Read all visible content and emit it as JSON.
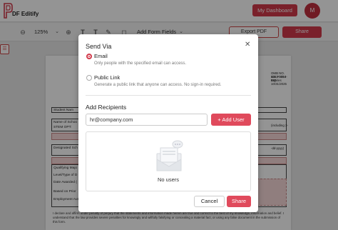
{
  "app": {
    "logo_text": "DF Editify"
  },
  "header": {
    "dashboard_label": "My Dashboard",
    "avatar_initial": "M"
  },
  "toolbar": {
    "zoom": "125%",
    "add_form_fields": "Add Form Fields",
    "export_label": "Export PDF",
    "share_label": "Share"
  },
  "document": {
    "labels": [
      "Student Nam",
      "Name of Schoo",
      "STEM OPT:",
      "Designated Sch",
      "Qualifying Majo",
      "Level/Type of D",
      "Date Awarded (",
      "Based on Prior",
      "Employment Aut"
    ],
    "right_texts": [
      "OMB NO. 1653-0054",
      "ICE Form I-983",
      "Expires 10/31/2025",
      "(including 3-",
      "-dd-yyyy)"
    ],
    "paragraph": "I declare and affirm under penalty of perjury that the statements and information made herein are true and correct to the best of my knowledge, information and belief. I understand that the law provides severe penalties for knowingly and willfully falsifying or concealing a material fact, or using any false document in the submission of this form."
  },
  "modal": {
    "title": "Send Via",
    "options": [
      {
        "label": "Email",
        "description": "Only people with the specified email can access.",
        "selected": true
      },
      {
        "label": "Public Link",
        "description": "Generate a public link that anyone can access. No sign-in required.",
        "selected": false
      }
    ],
    "recipients_title": "Add Recipients",
    "email_value": "hr@company.com",
    "add_user_label": "+ Add User",
    "empty_label": "No users",
    "cancel_label": "Cancel",
    "share_label": "Share"
  },
  "colors": {
    "accent": "#d23a4b",
    "overlay": "rgba(0,0,0,0.42)"
  },
  "icons": [
    "logo-icon",
    "zoom-out-icon",
    "zoom-in-icon",
    "text-icon",
    "text-size-icon",
    "edit-icon",
    "chevron-down-icon",
    "close-icon",
    "users-icon",
    "sidebar-toggle-icon"
  ]
}
